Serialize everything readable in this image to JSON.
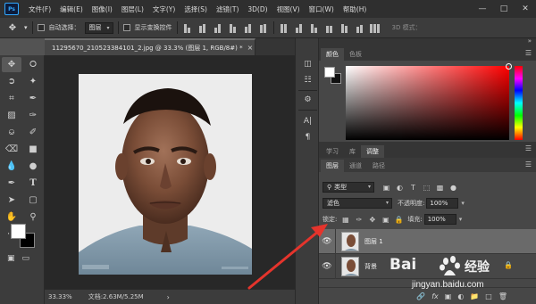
{
  "app": {
    "logo": "Ps",
    "menu": [
      "文件(F)",
      "编辑(E)",
      "图像(I)",
      "图层(L)",
      "文字(Y)",
      "选择(S)",
      "滤镜(T)",
      "3D(D)",
      "视图(V)",
      "窗口(W)",
      "帮助(H)"
    ],
    "window_controls": [
      "minimize",
      "maximize",
      "close"
    ]
  },
  "options_bar": {
    "auto_select_label": "自动选择：",
    "auto_select_value": "图层",
    "show_transform_label": "显示变换控件",
    "mode_3d_label": "3D 模式："
  },
  "document": {
    "tab_title": "11295670_210523384101_2.jpg @ 33.3% (图层 1, RGB/8#) *",
    "zoom": "33.33%",
    "doc_info": "文档:2.63M/5.25M"
  },
  "panels": {
    "color_tabs": [
      "颜色",
      "色板"
    ],
    "learn_tabs": [
      "学习",
      "库",
      "调整"
    ],
    "layers_tabs": [
      "图层",
      "通道",
      "路径"
    ],
    "kind_filter": "类型",
    "blend_mode": "滤色",
    "opacity_label": "不透明度:",
    "opacity_value": "100%",
    "lock_label": "锁定:",
    "fill_label": "填充:",
    "fill_value": "100%",
    "layers": [
      {
        "name": "图层 1",
        "selected": true,
        "visible": true,
        "locked": false
      },
      {
        "name": "背景",
        "selected": false,
        "visible": true,
        "locked": true
      }
    ]
  },
  "watermark": {
    "brand": "Bai",
    "brand_suffix": "经验",
    "url": "jingyan.baidu.com"
  },
  "colors": {
    "menu_bg": "#2f2f2f",
    "panel_bg": "#474747",
    "annotation_arrow": "#e5342c",
    "foreground": "#ffffff",
    "background": "#000000"
  }
}
